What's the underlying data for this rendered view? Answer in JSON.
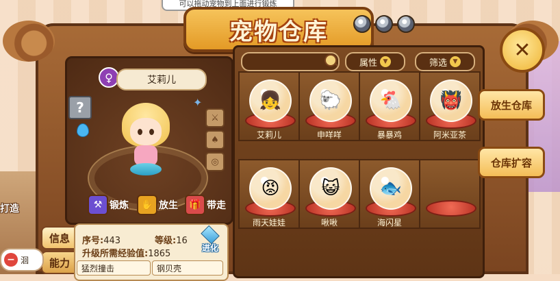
{
  "tip_text": "可以拖动宠物到上面进行锻炼",
  "title": "宠物仓库",
  "pet": {
    "gender_symbol": "♀",
    "name": "艾莉儿",
    "quality_symbol": "?",
    "serial_label": "序号:",
    "serial_value": "443",
    "level_label": "等级:",
    "level_value": "16",
    "exp_label": "升级所需经验值:",
    "exp_value": "1865",
    "skill_1": "猛烈撞击",
    "skill_2": "钢贝壳"
  },
  "actions": {
    "train": "锻炼",
    "release": "放生",
    "carry": "带走",
    "evolve": "进化"
  },
  "tabs": {
    "info": "信息",
    "ability": "能力"
  },
  "edge": {
    "forge": "打造",
    "stepper_text": "洄"
  },
  "filters": {
    "search_placeholder": "",
    "attribute": "属性",
    "filter": "筛选"
  },
  "side_buttons": {
    "release_warehouse": "放生仓库",
    "expand_warehouse": "仓库扩容"
  },
  "grid": [
    {
      "name": "艾莉儿",
      "emoji": "👧",
      "empty": false
    },
    {
      "name": "申咩咩",
      "emoji": "🐑",
      "empty": false
    },
    {
      "name": "暴暴鸡",
      "emoji": "🐔",
      "empty": false
    },
    {
      "name": "阿米亚茶",
      "emoji": "👹",
      "empty": false
    },
    {
      "name": "雨天娃娃",
      "emoji": "😡",
      "empty": false
    },
    {
      "name": "啾啾",
      "emoji": "😺",
      "empty": false
    },
    {
      "name": "海闪星",
      "emoji": "🐟",
      "empty": false
    },
    {
      "name": "",
      "emoji": "",
      "empty": true
    }
  ]
}
